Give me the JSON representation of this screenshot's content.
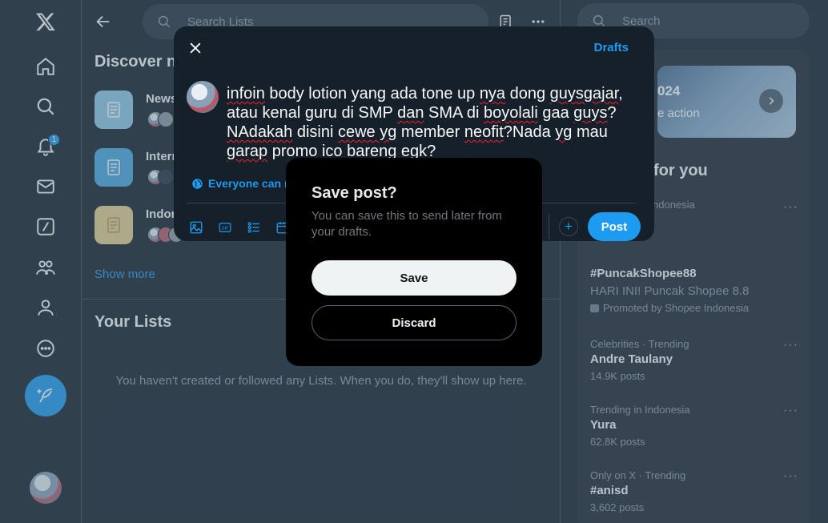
{
  "center": {
    "search_placeholder": "Search Lists",
    "discover_title": "Discover new Lists",
    "lists": [
      {
        "name": "News",
        "color": "#8ecae6"
      },
      {
        "name": "Internet",
        "color": "#4aa8e0"
      },
      {
        "name": "Indonesia",
        "color": "#e6cf8e"
      }
    ],
    "show_more": "Show more",
    "your_lists_title": "Your Lists",
    "empty_message": "You haven't created or followed any Lists. When you do, they'll show up here."
  },
  "right": {
    "search_placeholder": "Search",
    "banner_year": "024",
    "banner_sub": "e action",
    "trends_title": "for you",
    "trends": [
      {
        "meta": "ndonesia",
        "name": "",
        "count": ""
      },
      {
        "name": "#PuncakShopee88",
        "desc": "HARI INI! Puncak Shopee 8.8",
        "promo": "Promoted by Shopee Indonesia"
      },
      {
        "meta": "Celebrities · Trending",
        "name": "Andre Taulany",
        "count": "14.9K posts"
      },
      {
        "meta": "Trending in Indonesia",
        "name": "Yura",
        "count": "62.8K posts"
      },
      {
        "meta": "Only on X · Trending",
        "name": "#anisd",
        "count": "3,602 posts"
      }
    ],
    "more_glyph": "···"
  },
  "nav": {
    "notifications_count": "1"
  },
  "compose": {
    "drafts_label": "Drafts",
    "reply_setting": "Everyone can reply",
    "post_label": "Post",
    "add_glyph": "+"
  },
  "dialog": {
    "title": "Save post?",
    "body": "You can save this to send later from your drafts.",
    "save_label": "Save",
    "discard_label": "Discard"
  },
  "colors": {
    "accent": "#1d9bf0",
    "background": "#15202b",
    "dialog_bg": "#000000"
  }
}
